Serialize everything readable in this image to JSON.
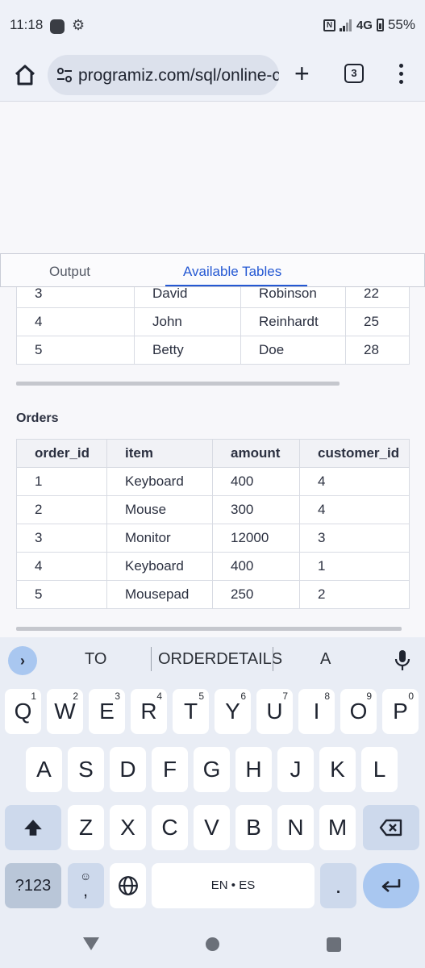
{
  "status_bar": {
    "time": "11:18",
    "network": "4G",
    "battery": "55%"
  },
  "browser": {
    "url": "programiz.com/sql/online-c",
    "tab_count": "3"
  },
  "panel_tabs": {
    "output": "Output",
    "available_tables": "Available Tables"
  },
  "customers_table": {
    "rows": [
      [
        "3",
        "David",
        "Robinson",
        "22"
      ],
      [
        "4",
        "John",
        "Reinhardt",
        "25"
      ],
      [
        "5",
        "Betty",
        "Doe",
        "28"
      ]
    ]
  },
  "orders_table": {
    "title": "Orders",
    "headers": [
      "order_id",
      "item",
      "amount",
      "customer_id"
    ],
    "rows": [
      [
        "1",
        "Keyboard",
        "400",
        "4"
      ],
      [
        "2",
        "Mouse",
        "300",
        "4"
      ],
      [
        "3",
        "Monitor",
        "12000",
        "3"
      ],
      [
        "4",
        "Keyboard",
        "400",
        "1"
      ],
      [
        "5",
        "Mousepad",
        "250",
        "2"
      ]
    ]
  },
  "keyboard": {
    "suggestions": [
      "TO",
      "ORDERDETAILS",
      "A"
    ],
    "row1": [
      [
        "Q",
        "1"
      ],
      [
        "W",
        "2"
      ],
      [
        "E",
        "3"
      ],
      [
        "R",
        "4"
      ],
      [
        "T",
        "5"
      ],
      [
        "Y",
        "6"
      ],
      [
        "U",
        "7"
      ],
      [
        "I",
        "8"
      ],
      [
        "O",
        "9"
      ],
      [
        "P",
        "0"
      ]
    ],
    "row2": [
      "A",
      "S",
      "D",
      "F",
      "G",
      "H",
      "J",
      "K",
      "L"
    ],
    "row3": [
      "Z",
      "X",
      "C",
      "V",
      "B",
      "N",
      "M"
    ],
    "symbols_label": "?123",
    "comma": ",",
    "space_label": "EN • ES",
    "period": "."
  },
  "colors": {
    "accent": "#2458d3",
    "keyboard_bg": "#e9edf5",
    "enter_key": "#a9c7f0"
  }
}
